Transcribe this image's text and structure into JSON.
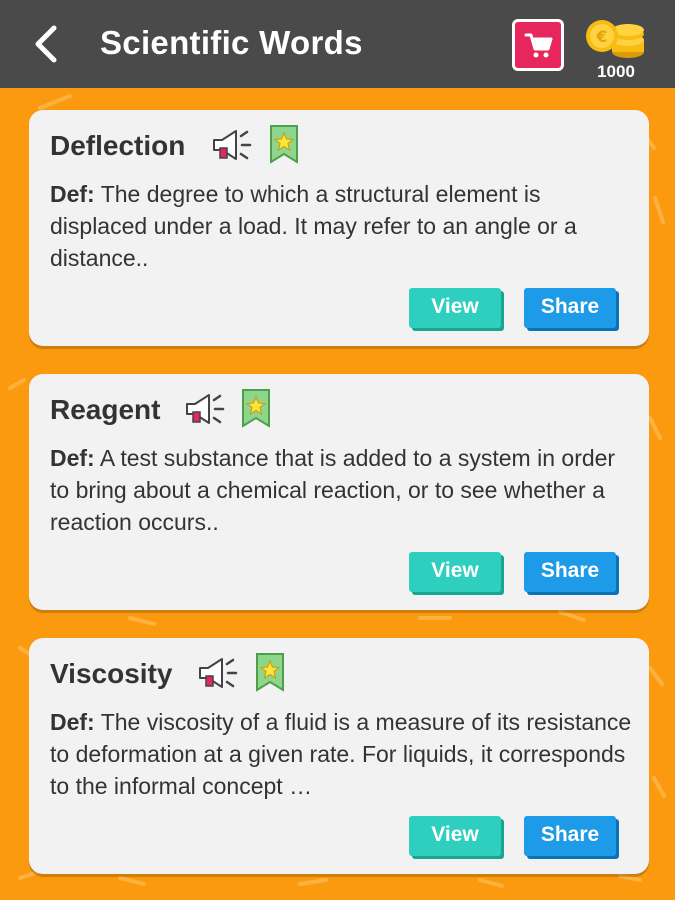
{
  "header": {
    "title": "Scientific Words",
    "coins": "1000"
  },
  "words": [
    {
      "word": "Deflection",
      "def_label": "Def:",
      "definition": "The degree to which a structural element is displaced under a load. It may refer to an angle or a distance..",
      "view_label": "View",
      "share_label": "Share"
    },
    {
      "word": "Reagent",
      "def_label": "Def:",
      "definition": "A test substance that is added to a system in order to bring about a chemical reaction, or to see whether a reaction occurs..",
      "view_label": "View",
      "share_label": "Share"
    },
    {
      "word": "Viscosity",
      "def_label": "Def:",
      "definition": "The viscosity of a fluid is a measure of its resistance to deformation at a given rate. For liquids, it corresponds to the informal concept …",
      "view_label": "View",
      "share_label": "Share"
    }
  ],
  "colors": {
    "background": "#fb9a0f",
    "topbar": "#4a4a4a",
    "cart": "#e6265c",
    "view_button": "#2ecfbe",
    "share_button": "#1e9be8",
    "bookmark": "#8ed68c"
  },
  "icons": [
    "back-arrow-icon",
    "cart-icon",
    "coins-icon",
    "speaker-icon",
    "bookmark-star-icon"
  ]
}
